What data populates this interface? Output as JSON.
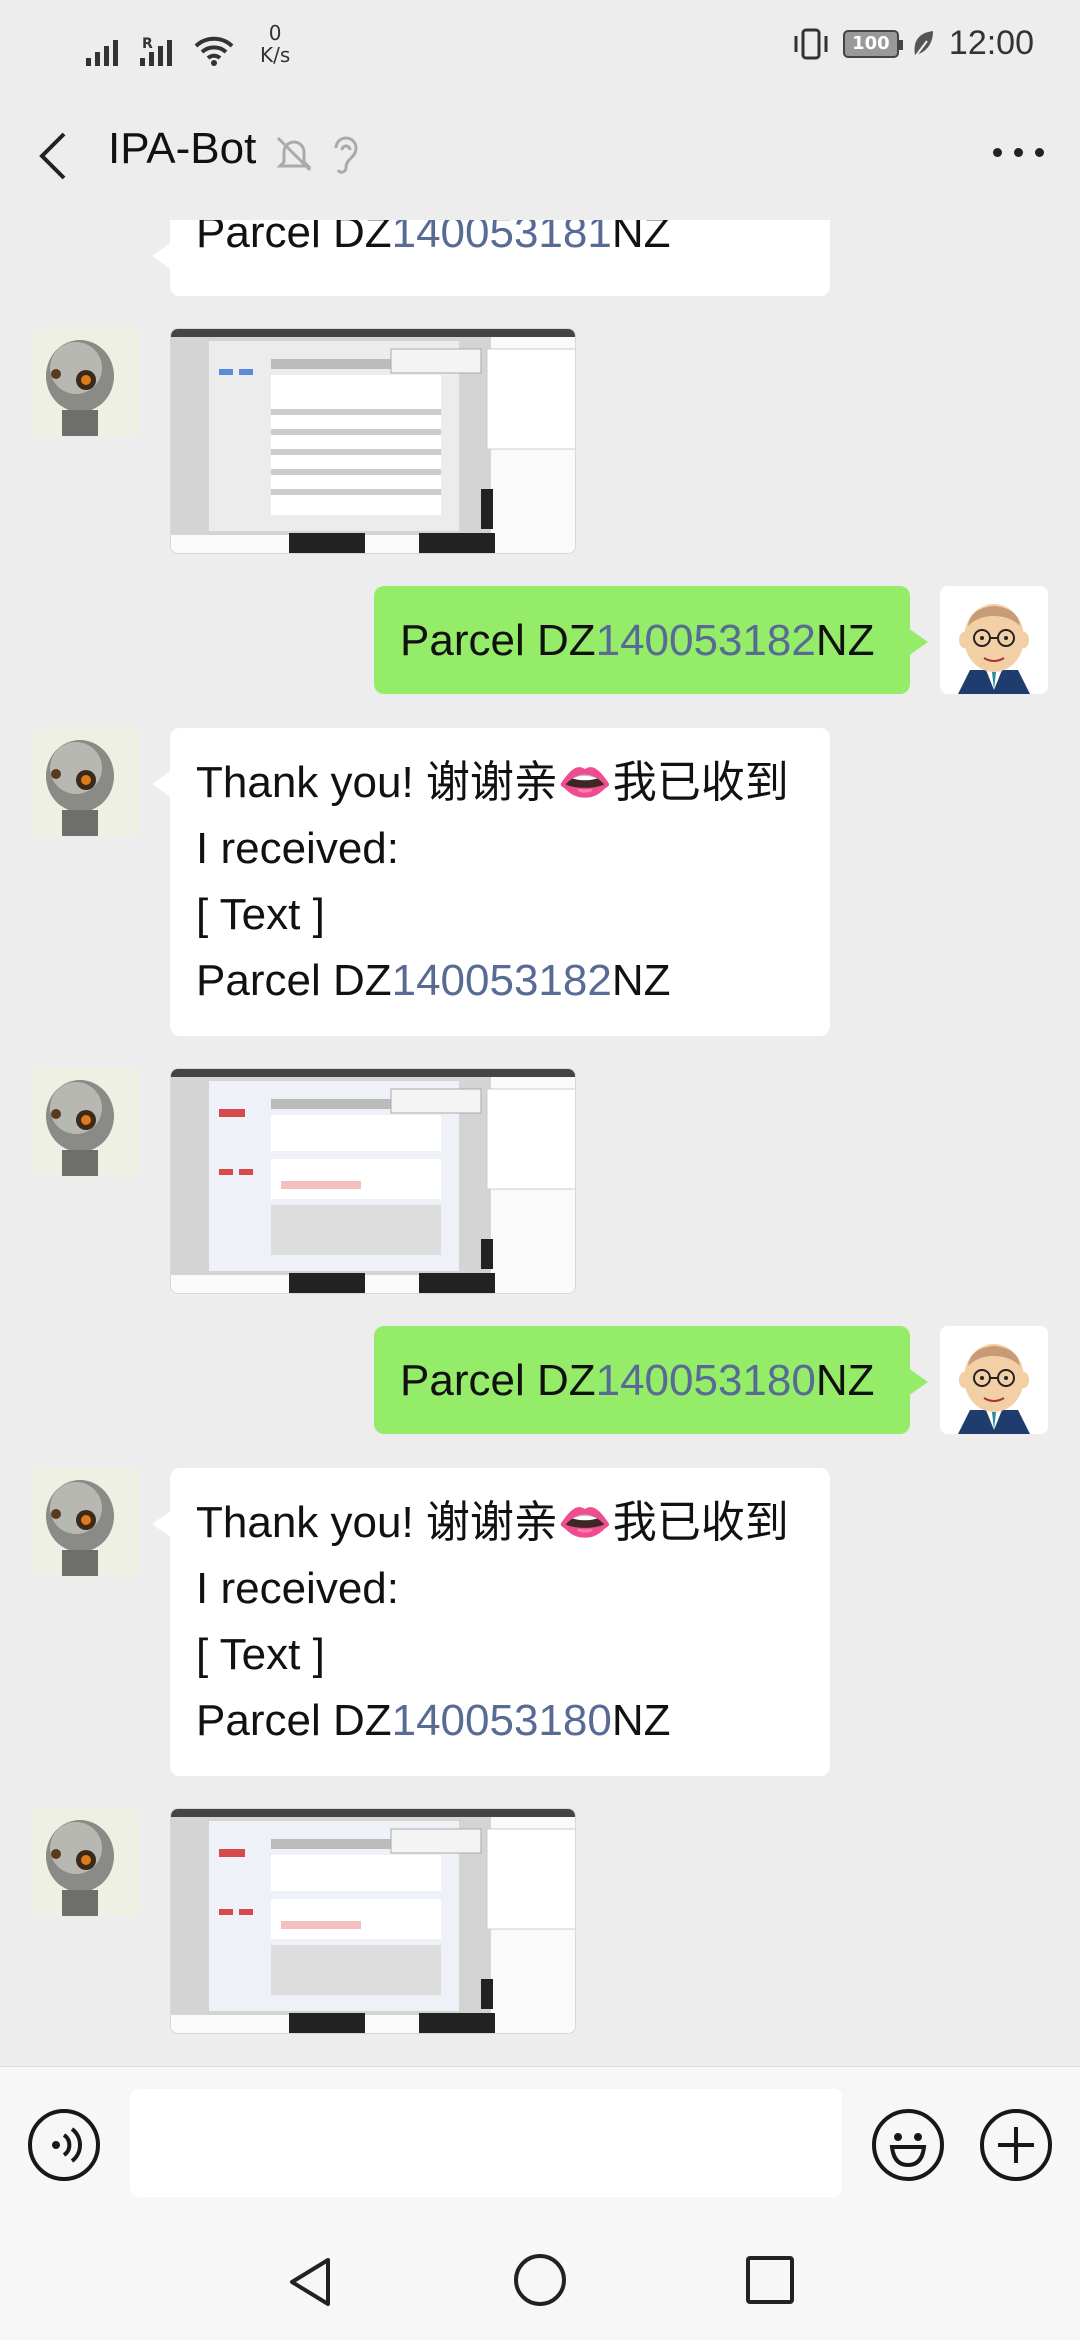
{
  "status_bar": {
    "net_speed_value": "0",
    "net_speed_unit": "K/s",
    "roaming_mark": "R",
    "battery": "100",
    "time": "12:00"
  },
  "header": {
    "title": "IPA-Bot",
    "icons": [
      "back-arrow-icon",
      "mute-bell-icon",
      "earpiece-icon",
      "more-dots-icon"
    ]
  },
  "messages": {
    "m0": {
      "prefix": "Parcel DZ",
      "number": "140053181",
      "suffix": "NZ"
    },
    "m2": {
      "prefix": "Parcel DZ",
      "number": "140053182",
      "suffix": "NZ"
    },
    "m3": {
      "thanks": "Thank you! 谢谢亲",
      "lips": "👄",
      "received_cn": "我已收到",
      "received_en": "I received:",
      "type": "[ Text ]",
      "prefix": "Parcel DZ",
      "number": "140053182",
      "suffix": "NZ"
    },
    "m5": {
      "prefix": "Parcel DZ",
      "number": "140053180",
      "suffix": "NZ"
    },
    "m6": {
      "thanks": "Thank you! 谢谢亲",
      "lips": "👄",
      "received_cn": "我已收到",
      "received_en": "I received:",
      "type": "[ Text ]",
      "prefix": "Parcel DZ",
      "number": "140053180",
      "suffix": "NZ"
    }
  },
  "input": {
    "placeholder": ""
  },
  "colors": {
    "sent_bubble": "#95ec69",
    "link_number": "#576b95",
    "background": "#ededed"
  }
}
